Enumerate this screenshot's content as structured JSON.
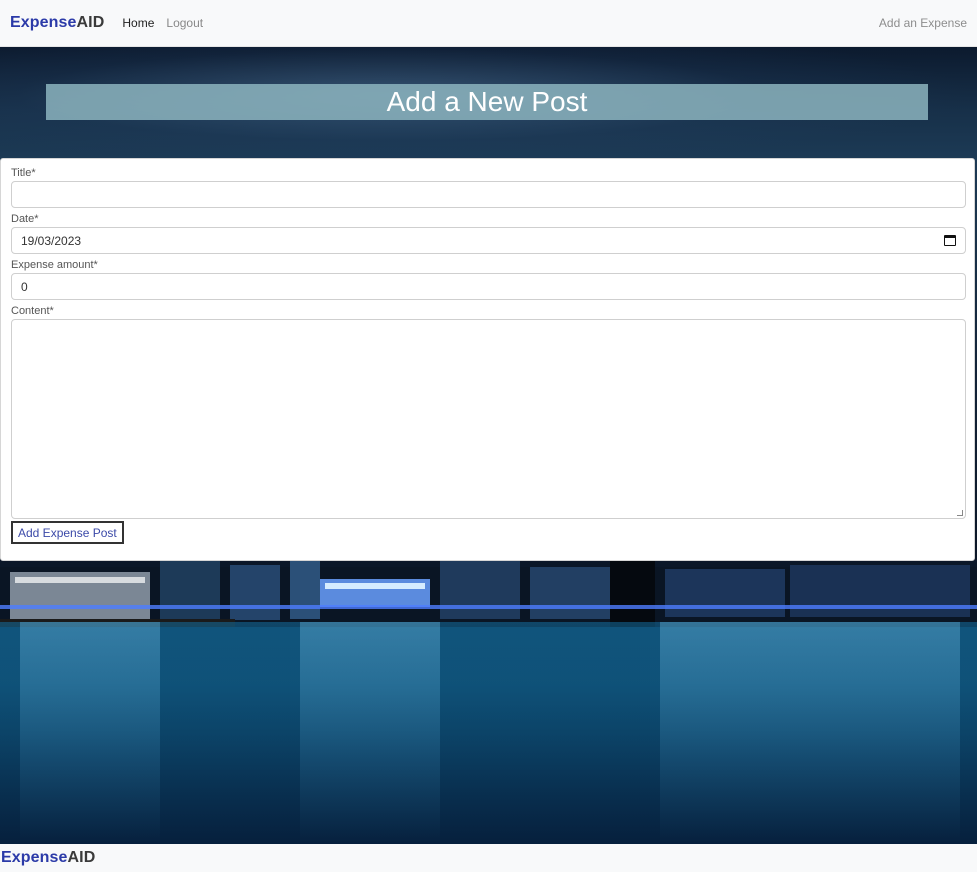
{
  "navbar": {
    "brand_part1": "Expense",
    "brand_part2": "AID",
    "links": {
      "home": "Home",
      "logout": "Logout"
    },
    "right_link": "Add an Expense"
  },
  "page": {
    "heading": "Add a New Post"
  },
  "form": {
    "title_label": "Title*",
    "title_value": "",
    "date_label": "Date*",
    "date_value": "19/03/2023",
    "amount_label": "Expense amount*",
    "amount_value": "0",
    "content_label": "Content*",
    "content_value": "",
    "submit_label": "Add Expense Post"
  },
  "footer": {
    "brand_part1": "Expense",
    "brand_part2": "AID"
  },
  "colors": {
    "brand_blue": "#2b3aa8",
    "brand_dark": "#3a3a3a",
    "banner_bg": "#8cb4be",
    "button_text": "#3b49a8"
  },
  "icons": {
    "date_picker": "calendar-icon",
    "textarea_resize": "resize-handle-icon"
  }
}
